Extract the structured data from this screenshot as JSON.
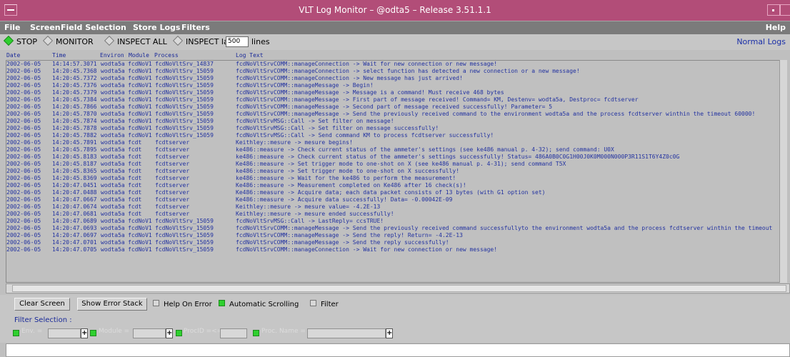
{
  "window": {
    "title": "VLT Log Monitor – @odta5 – Release 3.51.1.1"
  },
  "menu": {
    "file": "File",
    "screen": "Screen",
    "field_selection": "Field Selection",
    "store_logs": "Store Logs",
    "filters": "Filters",
    "help": "Help"
  },
  "modes": {
    "stop": "STOP",
    "monitor": "MONITOR",
    "inspect_all": "INSPECT ALL",
    "inspect_last": "INSPECT last",
    "lines_value": "500",
    "lines_suffix": "lines",
    "selected": "STOP",
    "normal_logs": "Normal Logs"
  },
  "columns": {
    "date": "Date",
    "time": "Time",
    "environ": "Environ",
    "module": "Module",
    "process": "Process",
    "logtext": "Log Text"
  },
  "rows": [
    {
      "date": "2002-06-05",
      "time": "14:14:57.3071",
      "env": "wodta5a",
      "mod": "fcdNoV1",
      "proc": "fcdNoVltSrv_14837",
      "text": "fcdNoVltSrvCOMM::manageConnection -> Wait for new connection or new message!"
    },
    {
      "date": "2002-06-05",
      "time": "14:20:45.7368",
      "env": "wodta5a",
      "mod": "fcdNoV1",
      "proc": "fcdNoVltSrv_15059",
      "text": "fcdNoVltSrvCOMM::manageConnection -> select function has detected a new connection or a new message!"
    },
    {
      "date": "2002-06-05",
      "time": "14:20:45.7372",
      "env": "wodta5a",
      "mod": "fcdNoV1",
      "proc": "fcdNoVltSrv_15059",
      "text": "fcdNoVltSrvCOMM::manageConnection -> New message has just arrived!"
    },
    {
      "date": "2002-06-05",
      "time": "14:20:45.7376",
      "env": "wodta5a",
      "mod": "fcdNoV1",
      "proc": "fcdNoVltSrv_15059",
      "text": "fcdNoVltSrvCOMM::manageMessage -> Begin!"
    },
    {
      "date": "2002-06-05",
      "time": "14:20:45.7379",
      "env": "wodta5a",
      "mod": "fcdNoV1",
      "proc": "fcdNoVltSrv_15059",
      "text": "fcdNoVltSrvCOMM::manageMessage -> Message is a command! Must receive 468 bytes"
    },
    {
      "date": "2002-06-05",
      "time": "14:20:45.7384",
      "env": "wodta5a",
      "mod": "fcdNoV1",
      "proc": "fcdNoVltSrv_15059",
      "text": "fcdNoVltSrvCOMM::manageMessage -> First part of message received! Command= KM, Destenv= wodta5a, Destproc= fcdtserver"
    },
    {
      "date": "2002-06-05",
      "time": "14:20:45.7866",
      "env": "wodta5a",
      "mod": "fcdNoV1",
      "proc": "fcdNoVltSrv_15059",
      "text": "fcdNoVltSrvCOMM::manageMessage -> Second part of message received successfully! Parameter= 5"
    },
    {
      "date": "2002-06-05",
      "time": "14:20:45.7870",
      "env": "wodta5a",
      "mod": "fcdNoV1",
      "proc": "fcdNoVltSrv_15059",
      "text": "fcdNoVltSrvCOMM::manageMessage -> Send the previously received command to the environment wodta5a and the process fcdtserver winthin the timeout 60000!"
    },
    {
      "date": "2002-06-05",
      "time": "14:20:45.7874",
      "env": "wodta5a",
      "mod": "fcdNoV1",
      "proc": "fcdNoVltSrv_15059",
      "text": "fcdNoVltSrvMSG::Call -> Set filter on message!"
    },
    {
      "date": "2002-06-05",
      "time": "14:20:45.7878",
      "env": "wodta5a",
      "mod": "fcdNoV1",
      "proc": "fcdNoVltSrv_15059",
      "text": "fcdNoVltSrvMSG::Call -> Set filter on message successfully!"
    },
    {
      "date": "2002-06-05",
      "time": "14:20:45.7882",
      "env": "wodta5a",
      "mod": "fcdNoV1",
      "proc": "fcdNoVltSrv_15059",
      "text": "fcdNoVltSrvMSG::Call -> Send command KM to process fcdtserver successfully!"
    },
    {
      "date": "2002-06-05",
      "time": "14:20:45.7891",
      "env": "wodta5a",
      "mod": "fcdt",
      "proc": "fcdtserver",
      "text": "Keithley::mesure -> mesure begins!"
    },
    {
      "date": "2002-06-05",
      "time": "14:20:45.7895",
      "env": "wodta5a",
      "mod": "fcdt",
      "proc": "fcdtserver",
      "text": "ke486::measure -> Check current status of the ammeter's settings (see ke486 manual p. 4-32); send command: U0X"
    },
    {
      "date": "2002-06-05",
      "time": "14:20:45.8183",
      "env": "wodta5a",
      "mod": "fcdt",
      "proc": "fcdtserver",
      "text": "ke486::measure -> Check current status of the ammeter's settings successfully! Status= 486A0B0C0G1H00J0K0M000N000P3R11S1T6Y4Z0c0G"
    },
    {
      "date": "2002-06-05",
      "time": "14:20:45.8187",
      "env": "wodta5a",
      "mod": "fcdt",
      "proc": "fcdtserver",
      "text": "Ke486::measure -> Set trigger mode to one-shot on X (see ke486 manual p. 4-31); send command T5X"
    },
    {
      "date": "2002-06-05",
      "time": "14:20:45.8365",
      "env": "wodta5a",
      "mod": "fcdt",
      "proc": "fcdtserver",
      "text": "ke486::measure -> Set trigger mode to one-shot on X successfully!"
    },
    {
      "date": "2002-06-05",
      "time": "14:20:45.8369",
      "env": "wodta5a",
      "mod": "fcdt",
      "proc": "fcdtserver",
      "text": "ke486::measure -> Wait for the ke486 to perform the measurement!"
    },
    {
      "date": "2002-06-05",
      "time": "14:20:47.0451",
      "env": "wodta5a",
      "mod": "fcdt",
      "proc": "fcdtserver",
      "text": "Ke486::measure -> Measurement completed on Ke486 after 16 check(s)!"
    },
    {
      "date": "2002-06-05",
      "time": "14:20:47.0488",
      "env": "wodta5a",
      "mod": "fcdt",
      "proc": "fcdtserver",
      "text": "Ke486::measure -> Acquire data; each data packet consists of 13 bytes (with G1 option set)"
    },
    {
      "date": "2002-06-05",
      "time": "14:20:47.0667",
      "env": "wodta5a",
      "mod": "fcdt",
      "proc": "fcdtserver",
      "text": "Ke486::measure -> Acquire data successfully! Data= -0.00042E-09"
    },
    {
      "date": "2002-06-05",
      "time": "14:20:47.0674",
      "env": "wodta5a",
      "mod": "fcdt",
      "proc": "fcdtserver",
      "text": "Keithley::mesure -> mesure value= -4.2E-13"
    },
    {
      "date": "2002-06-05",
      "time": "14:20:47.0681",
      "env": "wodta5a",
      "mod": "fcdt",
      "proc": "fcdtserver",
      "text": "Keithley::mesure -> mesure ended successfully!"
    },
    {
      "date": "2002-06-05",
      "time": "14:20:47.0689",
      "env": "wodta5a",
      "mod": "fcdNoV1",
      "proc": "fcdNoVltSrv_15059",
      "text": "fcdNoVltSrvMSG::Call -> LastReply= ccsTRUE!"
    },
    {
      "date": "2002-06-05",
      "time": "14:20:47.0693",
      "env": "wodta5a",
      "mod": "fcdNoV1",
      "proc": "fcdNoVltSrv_15059",
      "text": "fcdNoVltSrvCOMM::manageMessage -> Send the previously received command successfullyto the environment wodta5a and the process fcdtserver winthin the timeout"
    },
    {
      "date": "2002-06-05",
      "time": "14:20:47.0697",
      "env": "wodta5a",
      "mod": "fcdNoV1",
      "proc": "fcdNoVltSrv_15059",
      "text": "fcdNoVltSrvCOMM::manageMessage -> Send the reply! Return= -4.2E-13"
    },
    {
      "date": "2002-06-05",
      "time": "14:20:47.0701",
      "env": "wodta5a",
      "mod": "fcdNoV1",
      "proc": "fcdNoVltSrv_15059",
      "text": "fcdNoVltSrvCOMM::manageMessage -> Send the reply successfully!"
    },
    {
      "date": "2002-06-05",
      "time": "14:20:47.0705",
      "env": "wodta5a",
      "mod": "fcdNoV1",
      "proc": "fcdNoVltSrv_15059",
      "text": "fcdNoVltSrvCOMM::manageConnection -> Wait for new connection or new message!"
    }
  ],
  "bottom": {
    "clear_screen": "Clear Screen",
    "show_error_stack": "Show Error Stack",
    "help_on_error": "Help On Error",
    "auto_scrolling": "Automatic Scrolling",
    "filter": "Filter",
    "filter_selection": "Filter Selection :",
    "env_label": "Env. =",
    "module_label": "Module =",
    "procid_label": "ProcID =<=",
    "procname_label": "Proc. Name ="
  },
  "colors": {
    "titlebar": "#b24d78",
    "menubar": "#7b7b7b",
    "log_text": "#2232a0",
    "active_indicator": "#2fd02f"
  }
}
